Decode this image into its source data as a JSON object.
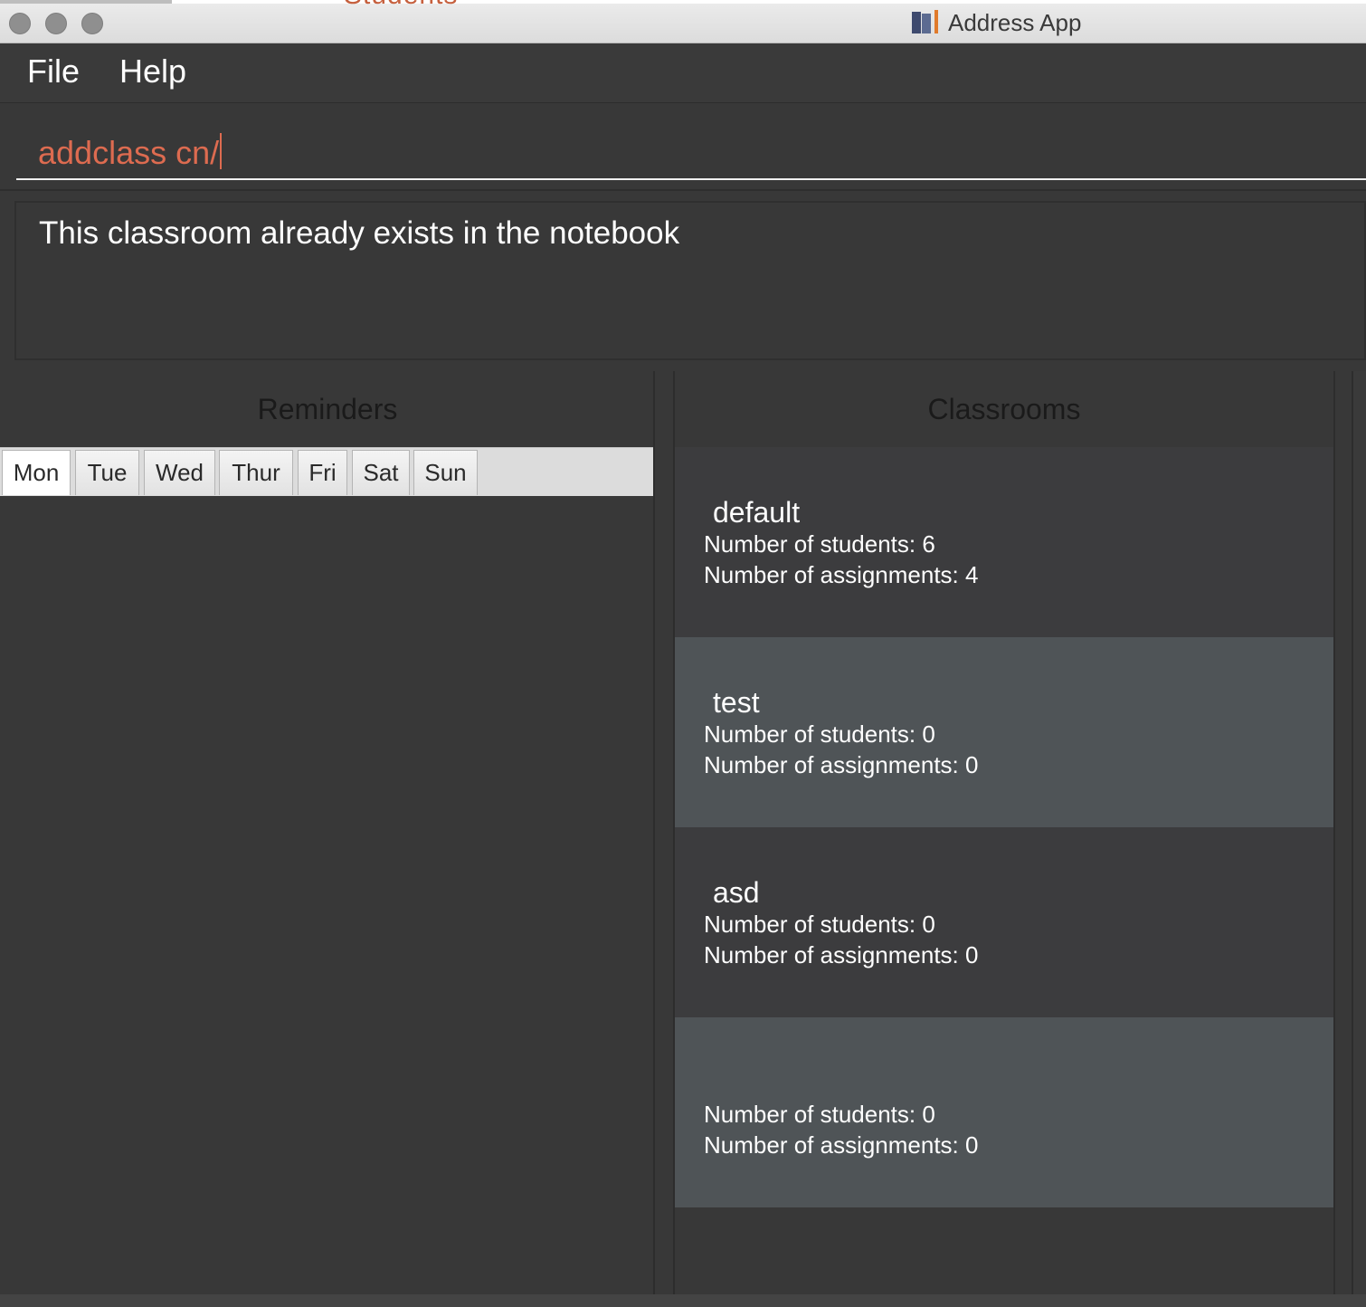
{
  "window": {
    "title": "Address App",
    "background_peek_text": "Students"
  },
  "menu": {
    "items": [
      "File",
      "Help"
    ]
  },
  "command": {
    "value": "addclass cn/"
  },
  "result": {
    "message": "This classroom already exists in the notebook"
  },
  "reminders": {
    "title": "Reminders",
    "days": [
      "Mon",
      "Tue",
      "Wed",
      "Thur",
      "Fri",
      "Sat",
      "Sun"
    ],
    "selected_day": "Mon"
  },
  "classrooms": {
    "title": "Classrooms",
    "items": [
      {
        "name": "default",
        "students": "Number of students: 6",
        "assignments": "Number of assignments: 4"
      },
      {
        "name": "test",
        "students": "Number of students: 0",
        "assignments": "Number of assignments: 0"
      },
      {
        "name": "asd",
        "students": "Number of students: 0",
        "assignments": "Number of assignments: 0"
      },
      {
        "name": "",
        "students": "Number of students: 0",
        "assignments": "Number of assignments: 0"
      }
    ]
  },
  "colors": {
    "background": "#383838",
    "command_text": "#dd6b50",
    "card_dark": "#3c3c3e",
    "card_light": "#4f5457"
  }
}
